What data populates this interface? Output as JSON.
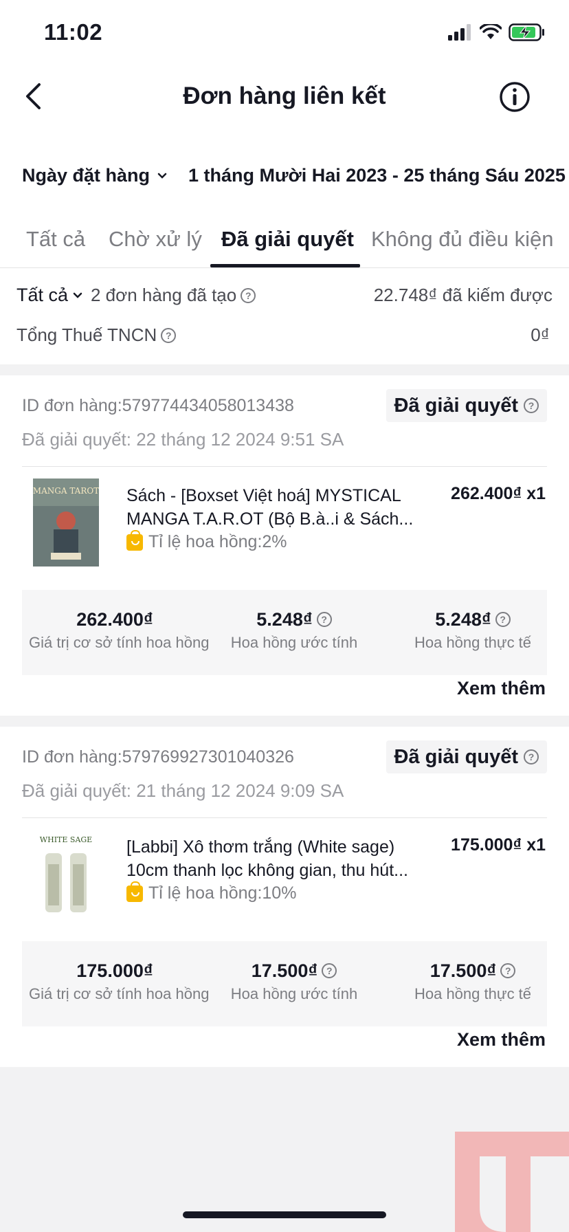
{
  "status_bar": {
    "time": "11:02"
  },
  "nav": {
    "title": "Đơn hàng liên kết",
    "back_icon": "chevron-left-icon",
    "info_icon": "info-icon"
  },
  "filter": {
    "date_label": "Ngày đặt hàng",
    "date_range": "1 tháng Mười Hai 2023 - 25 tháng Sáu 2025"
  },
  "tabs": [
    {
      "label": "Tất cả",
      "active": false
    },
    {
      "label": "Chờ xử lý",
      "active": false
    },
    {
      "label": "Đã giải quyết",
      "active": true
    },
    {
      "label": "Không đủ điều kiện",
      "active": false
    }
  ],
  "summary": {
    "filter_label": "Tất cả",
    "orders_created": "2 đơn hàng đã tạo",
    "earned": "22.748₫ đã kiếm được",
    "tax_label": "Tổng Thuế TNCN",
    "tax_value": "0₫"
  },
  "orders": [
    {
      "id": "ID đơn hàng:579774434058013438",
      "status": "Đã giải quyết",
      "resolved_date": "Đã giải quyết: 22 tháng 12 2024 9:51 SA",
      "product_name": "Sách - [Boxset Việt hoá] MYSTICAL MANGA T.A.R.OT (Bộ B.à..i & Sách...",
      "price": "262.400₫ x1",
      "commission_rate": "Tỉ lệ hoa hồng:2%",
      "thumb_title": "MANGA TAROT",
      "base_value": "262.400₫",
      "base_label": "Giá trị cơ sở tính hoa hồng",
      "est_value": "5.248₫",
      "est_label": "Hoa hồng ước tính",
      "actual_value": "5.248₫",
      "actual_label": "Hoa hồng thực tế",
      "see_more": "Xem thêm"
    },
    {
      "id": "ID đơn hàng:579769927301040326",
      "status": "Đã giải quyết",
      "resolved_date": "Đã giải quyết: 21 tháng 12 2024 9:09 SA",
      "product_name": "[Labbi] Xô thơm trắng (White sage) 10cm thanh lọc không gian, thu hút...",
      "price": "175.000₫ x1",
      "commission_rate": "Tỉ lệ hoa hồng:10%",
      "thumb_title": "WHITE SAGE",
      "base_value": "175.000₫",
      "base_label": "Giá trị cơ sở tính hoa hồng",
      "est_value": "17.500₫",
      "est_label": "Hoa hồng ước tính",
      "actual_value": "17.500₫",
      "actual_label": "Hoa hồng thực tế",
      "see_more": "Xem thêm"
    }
  ]
}
